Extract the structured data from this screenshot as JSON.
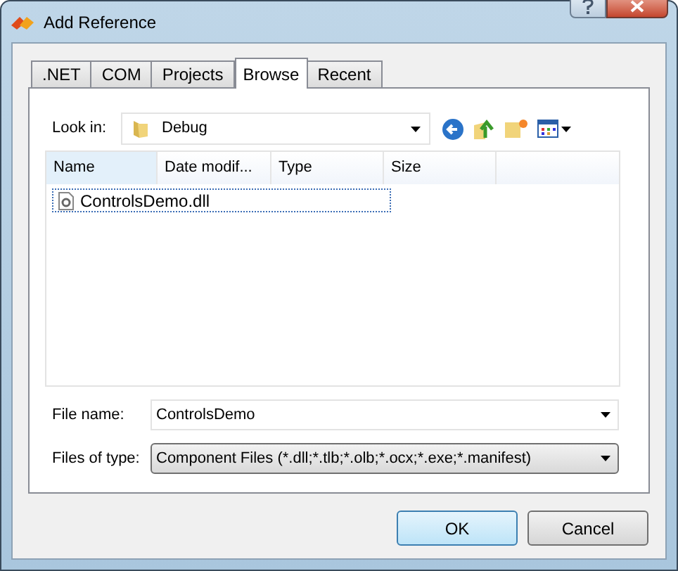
{
  "window": {
    "title": "Add Reference"
  },
  "tabs": [
    {
      "label": ".NET",
      "selected": false
    },
    {
      "label": "COM",
      "selected": false
    },
    {
      "label": "Projects",
      "selected": false
    },
    {
      "label": "Browse",
      "selected": true
    },
    {
      "label": "Recent",
      "selected": false
    }
  ],
  "look_in": {
    "label": "Look in:",
    "value": "Debug"
  },
  "file_list": {
    "columns": [
      "Name",
      "Date modif...",
      "Type",
      "Size"
    ],
    "rows": [
      {
        "name": "ControlsDemo.dll",
        "selected": true
      }
    ]
  },
  "file_name": {
    "label": "File name:",
    "value": "ControlsDemo"
  },
  "files_of_type": {
    "label": "Files of type:",
    "value": "Component Files (*.dll;*.tlb;*.olb;*.ocx;*.exe;*.manifest)"
  },
  "buttons": [
    {
      "label": "OK",
      "default": true
    },
    {
      "label": "Cancel",
      "default": false
    }
  ]
}
